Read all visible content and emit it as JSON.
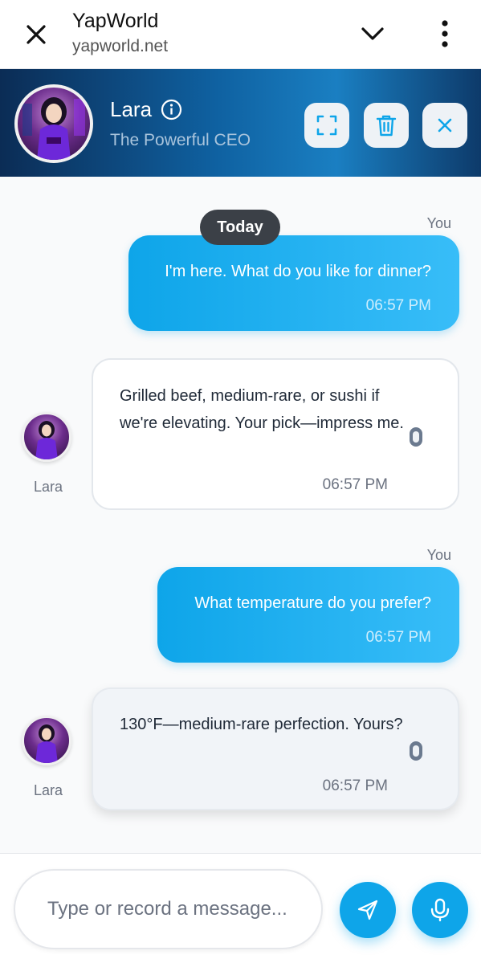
{
  "browser": {
    "title": "YapWorld",
    "url": "yapworld.net"
  },
  "character": {
    "name": "Lara",
    "subtitle": "The Powerful CEO"
  },
  "chat": {
    "date_divider": "Today",
    "messages": [
      {
        "sender": "You",
        "text": "I'm here. What do you like for dinner?",
        "time": "06:57 PM"
      },
      {
        "sender": "Lara",
        "text": "Grilled beef, medium-rare, or sushi if we're elevating. Your pick—impress me.",
        "time": "06:57 PM"
      },
      {
        "sender": "You",
        "text": "What temperature do you prefer?",
        "time": "06:57 PM"
      },
      {
        "sender": "Lara",
        "text": "130°F—medium-rare perfection. Yours?",
        "time": "06:57 PM"
      }
    ]
  },
  "composer": {
    "placeholder": "Type or record a message..."
  },
  "colors": {
    "accent": "#0ea5e9",
    "header_dark": "#0b2c55",
    "date_pill": "#3b4047"
  }
}
